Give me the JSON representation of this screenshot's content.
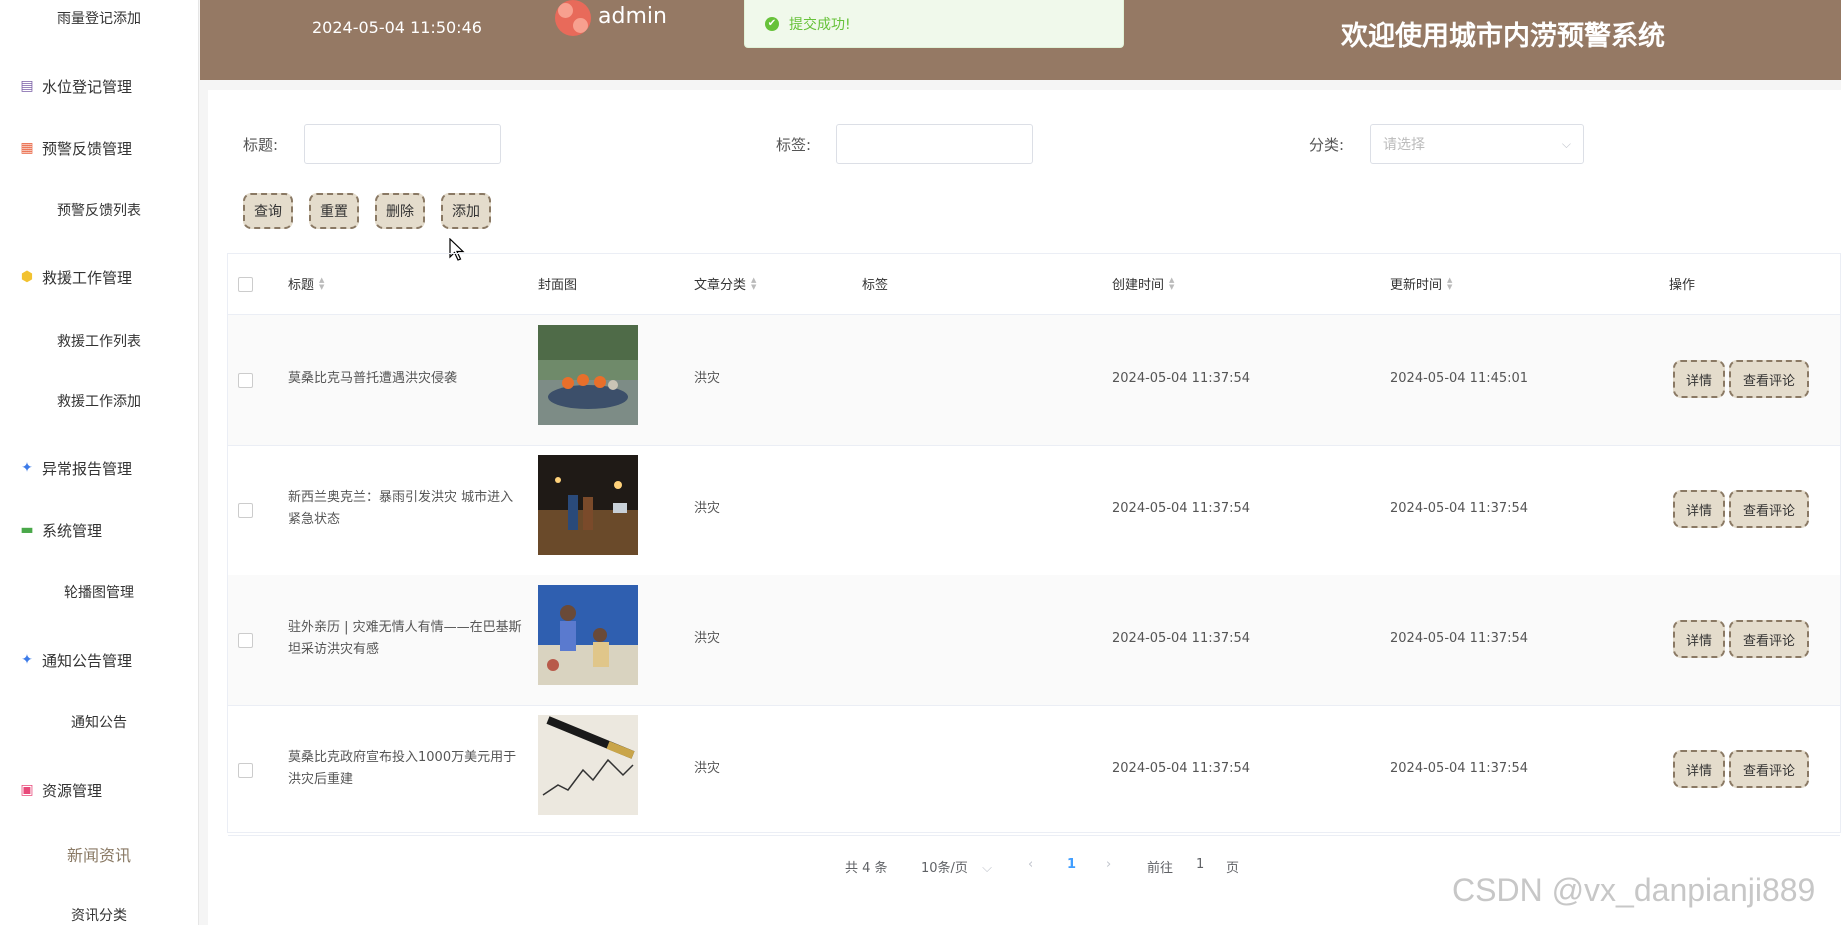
{
  "sidebar": {
    "items": [
      {
        "label": "雨量登记添加",
        "kind": "sub",
        "icon": ""
      },
      {
        "label": "水位登记管理",
        "kind": "group",
        "icon": "archive-icon",
        "icon_color": "#7a5ea6"
      },
      {
        "label": "预警反馈管理",
        "kind": "group",
        "icon": "grid-icon",
        "icon_color": "#e9623f"
      },
      {
        "label": "预警反馈列表",
        "kind": "sub",
        "icon": ""
      },
      {
        "label": "救援工作管理",
        "kind": "group",
        "icon": "cube-icon",
        "icon_color": "#f2c230"
      },
      {
        "label": "救援工作列表",
        "kind": "sub",
        "icon": ""
      },
      {
        "label": "救援工作添加",
        "kind": "sub",
        "icon": ""
      },
      {
        "label": "异常报告管理",
        "kind": "group",
        "icon": "star-icon",
        "icon_color": "#3d7be8"
      },
      {
        "label": "系统管理",
        "kind": "group",
        "icon": "message-icon",
        "icon_color": "#4aa84a"
      },
      {
        "label": "轮播图管理",
        "kind": "sub",
        "icon": ""
      },
      {
        "label": "通知公告管理",
        "kind": "group",
        "icon": "star-icon",
        "icon_color": "#3d7be8"
      },
      {
        "label": "通知公告",
        "kind": "sub",
        "icon": ""
      },
      {
        "label": "资源管理",
        "kind": "group",
        "icon": "clipboard-icon",
        "icon_color": "#e84a7a"
      },
      {
        "label": "新闻资讯",
        "kind": "sub-active",
        "icon": ""
      },
      {
        "label": "资讯分类",
        "kind": "sub",
        "icon": ""
      }
    ]
  },
  "header": {
    "datetime": "2024-05-04 11:50:46",
    "username": "admin",
    "site_title": "欢迎使用城市内涝预警系统",
    "bg_color": "#957964"
  },
  "toast": {
    "message": "提交成功!",
    "type": "success"
  },
  "filters": {
    "title_label": "标题:",
    "title_value": "",
    "tag_label": "标签:",
    "tag_value": "",
    "category_label": "分类:",
    "category_placeholder": "请选择"
  },
  "toolbar": {
    "query_label": "查询",
    "reset_label": "重置",
    "delete_label": "删除",
    "add_label": "添加"
  },
  "table": {
    "columns": {
      "title": "标题",
      "cover": "封面图",
      "category": "文章分类",
      "tags": "标签",
      "created": "创建时间",
      "updated": "更新时间",
      "actions": "操作"
    },
    "rows": [
      {
        "title": "莫桑比克马普托遭遇洪灾侵袭",
        "category": "洪灾",
        "tags": "",
        "created": "2024-05-04 11:37:54",
        "updated": "2024-05-04 11:45:01",
        "cover": "flood-rescue-boat"
      },
      {
        "title": "新西兰奥克兰：暴雨引发洪灾 城市进入紧急状态",
        "category": "洪灾",
        "tags": "",
        "created": "2024-05-04 11:37:54",
        "updated": "2024-05-04 11:37:54",
        "cover": "flooded-street-night"
      },
      {
        "title": "驻外亲历 | 灾难无情人有情——在巴基斯坦采访洪灾有感",
        "category": "洪灾",
        "tags": "",
        "created": "2024-05-04 11:37:54",
        "updated": "2024-05-04 11:37:54",
        "cover": "relief-tent"
      },
      {
        "title": "莫桑比克政府宣布投入1000万美元用于洪灾后重建",
        "category": "洪灾",
        "tags": "",
        "created": "2024-05-04 11:37:54",
        "updated": "2024-05-04 11:37:54",
        "cover": "pen-and-chart"
      }
    ],
    "detail_label": "详情",
    "comments_label": "查看评论"
  },
  "pagination": {
    "total": "共 4 条",
    "page_size": "10条/页",
    "current_page": "1",
    "goto_prefix": "前往",
    "goto_value": "1",
    "goto_suffix": "页"
  },
  "watermark": "CSDN @vx_danpianji889"
}
